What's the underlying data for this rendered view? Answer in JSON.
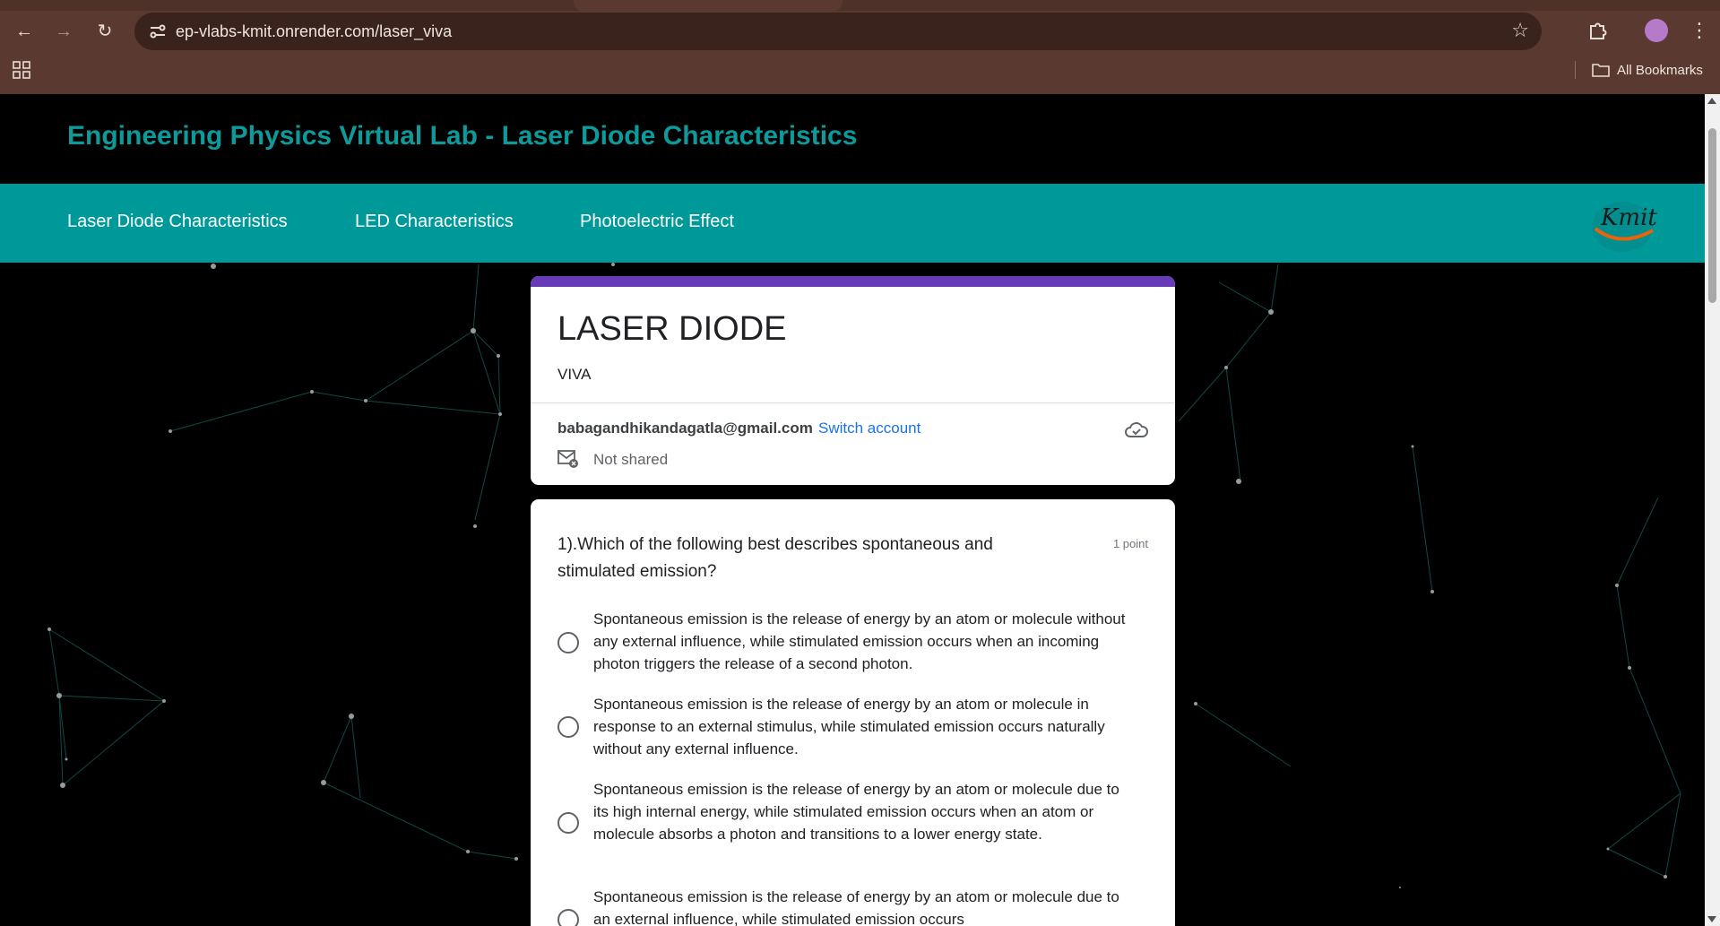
{
  "browser": {
    "url": "ep-vlabs-kmit.onrender.com/laser_viva",
    "bookmarks_label": "All Bookmarks",
    "icons": [
      "back-arrow-icon",
      "forward-arrow-icon",
      "reload-icon",
      "site-info-icon",
      "star-icon",
      "extensions-icon",
      "profile-avatar-icon",
      "kebab-menu-icon",
      "apps-grid-icon",
      "folder-icon"
    ]
  },
  "site": {
    "title": "Engineering Physics Virtual Lab - Laser Diode Characteristics",
    "title_color": "#0e9a9a",
    "nav_color": "#009999",
    "nav": [
      {
        "label": "Laser Diode Characteristics"
      },
      {
        "label": "LED Characteristics"
      },
      {
        "label": "Photoelectric Effect"
      }
    ],
    "logo_text": "Kmit"
  },
  "form": {
    "accent_color": "#673ab7",
    "title": "LASER DIODE",
    "subtitle": "VIVA",
    "email": "babagandhikandagatla@gmail.com",
    "switch_account": "Switch account",
    "not_shared": "Not shared"
  },
  "question": {
    "text": "1).Which of the following best describes spontaneous and stimulated emission?",
    "points": "1 point",
    "options": [
      {
        "text": "Spontaneous emission is the release of energy by an atom or molecule without any external influence, while stimulated emission occurs when an incoming photon triggers the release of a second photon."
      },
      {
        "text": "Spontaneous emission is the release of energy by an atom or molecule in response to an external stimulus, while stimulated emission occurs naturally without any external influence."
      },
      {
        "text": "Spontaneous emission is the release of energy by an atom or molecule due to its high internal energy, while stimulated emission occurs when an atom or molecule absorbs a photon and transitions to a lower energy state."
      },
      {
        "text": "Spontaneous emission is the release of energy by an atom or molecule due to an external influence, while stimulated emission occurs"
      }
    ]
  }
}
